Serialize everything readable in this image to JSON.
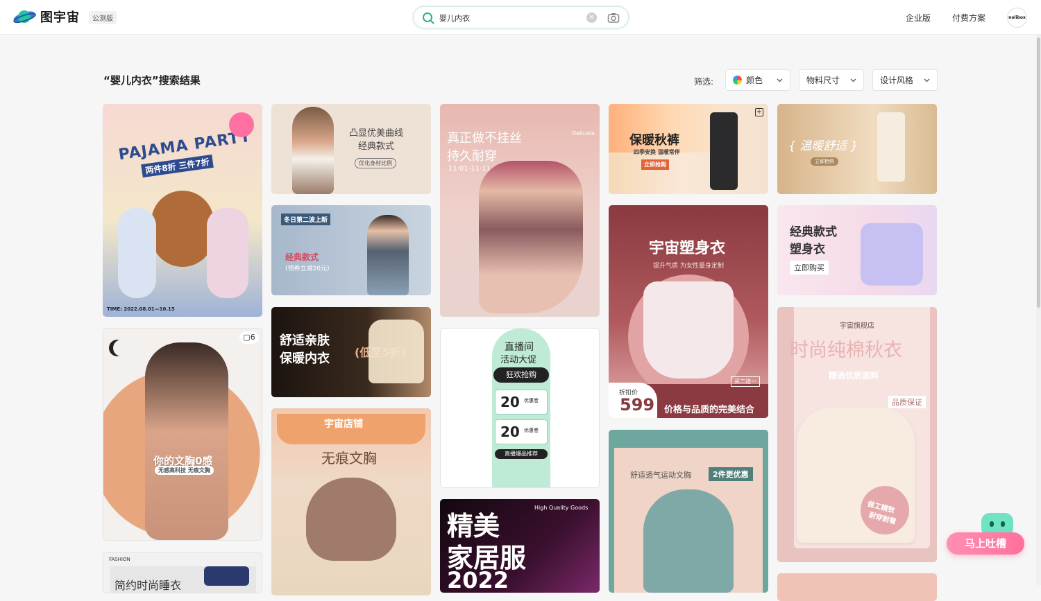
{
  "app": {
    "name": "图宇宙",
    "badge": "公测版"
  },
  "search": {
    "value": "婴儿内衣",
    "placeholder": ""
  },
  "nav": {
    "enterprise": "企业版",
    "pricing": "付费方案",
    "avatar_text": "nolibox"
  },
  "results": {
    "title": "“婴儿内衣”搜索结果"
  },
  "filters": {
    "label": "筛选:",
    "color": "颜色",
    "size": "物料尺寸",
    "style": "设计风格"
  },
  "feedback": {
    "label": "马上吐槽"
  },
  "cards": {
    "c1": {
      "title": "PAJAMA PARTY",
      "sub": "两件8折 三件7折",
      "footer": "TIME: 2022.08.01—10.15"
    },
    "c2": {
      "line1": "凸显优美曲线",
      "line2": "经典款式",
      "tag": "优化身材比例"
    },
    "c3": {
      "tag": "冬日第二波上新",
      "title": "经典款式",
      "sub": "(领券立减20元)"
    },
    "c4": {
      "line1": "舒适亲肤",
      "line2": "保暖内衣",
      "promo": "(低至5折)"
    },
    "c5": {
      "line1": "真正做不挂丝",
      "line2": "持久耐穿",
      "date": "11·01-11·11",
      "side": "Delicate"
    },
    "c6": {
      "line1": "直播间",
      "line2": "活动大促",
      "btn": "狂欢抢购",
      "coupon1": "20",
      "coupon2": "20",
      "coupon_label": "优惠卷",
      "rec": "直播爆品推荐"
    },
    "c7": {
      "title": "保暖秋裤",
      "sub": "四季安换 温暖常伴",
      "btn": "立即抢购"
    },
    "c8": {
      "title": "宇宙塑身衣",
      "sub": "提升气质 为女性量身定制",
      "price_label": "折扣价",
      "price": "599",
      "slogan": "价格与品质的完美结合",
      "tag": "买二送一"
    },
    "c9": {
      "title": "{ 温暖舒适 }",
      "btn": "立即抢购"
    },
    "c10": {
      "line1": "经典款式",
      "line2": "塑身衣",
      "btn": "立即购买"
    },
    "c11": {
      "brand": "宇宙旗舰店",
      "title": "时尚纯棉秋衣",
      "sub": "精选优质面料",
      "badge": "品质保证",
      "stamp1": "做工精致",
      "stamp2": "耐穿耐看"
    },
    "c12": {
      "count": "6",
      "title": "你的文胸0感",
      "sub": "无感高科技 无痕文胸"
    },
    "c13": {
      "brand": "宇宙店铺",
      "title": "无痕文胸"
    },
    "c14": {
      "text": "舒适透气运动文胸",
      "tag": "2件更优惠"
    },
    "c15": {
      "line1": "精美",
      "line2": "家居服",
      "line3": "2022",
      "tag": "High Quality Goods"
    },
    "c16": {
      "label": "FASHION",
      "title": "简约时尚睡衣"
    }
  },
  "colors": {
    "accent": "#2bb08a",
    "feedback": "#ff7aa3"
  }
}
